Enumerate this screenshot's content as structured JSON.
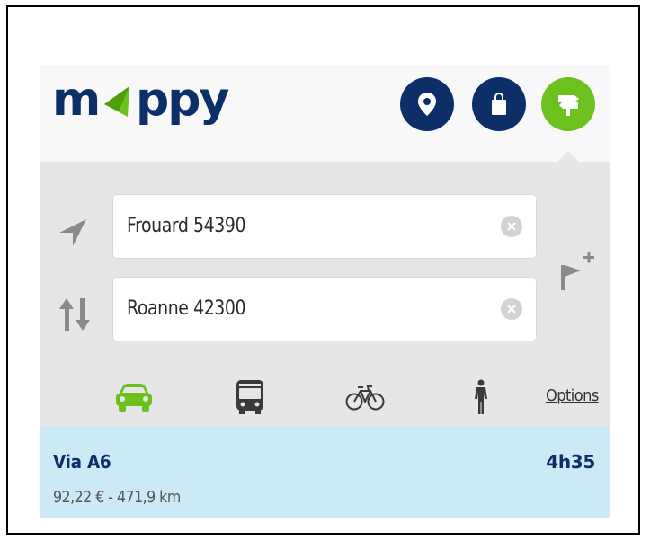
{
  "header": {
    "logo_text": "mappy",
    "buttons": [
      {
        "icon": "location-pin-icon",
        "color": "#0b2f66"
      },
      {
        "icon": "shopping-bag-icon",
        "color": "#0b2f66"
      },
      {
        "icon": "signpost-icon",
        "color": "#6cc11d"
      }
    ]
  },
  "search": {
    "from_value": "Frouard 54390",
    "to_value": "Roanne 42300",
    "icons": [
      "navigation-arrow-icon",
      "swap-icon",
      "add-step-flag-icon",
      "clear-icon"
    ]
  },
  "modes": {
    "items": [
      {
        "name": "car",
        "icon": "car-icon",
        "active": true
      },
      {
        "name": "bus",
        "icon": "bus-icon",
        "active": false
      },
      {
        "name": "bike",
        "icon": "bicycle-icon",
        "active": false
      },
      {
        "name": "walk",
        "icon": "pedestrian-icon",
        "active": false
      }
    ],
    "options_label": "Options",
    "active_color": "#6cc11d",
    "inactive_color": "#3a3a3a"
  },
  "result": {
    "title": "Via A6",
    "duration": "4h35",
    "details": "92,22 € - 471,9 km",
    "background": "#cce9f6"
  }
}
